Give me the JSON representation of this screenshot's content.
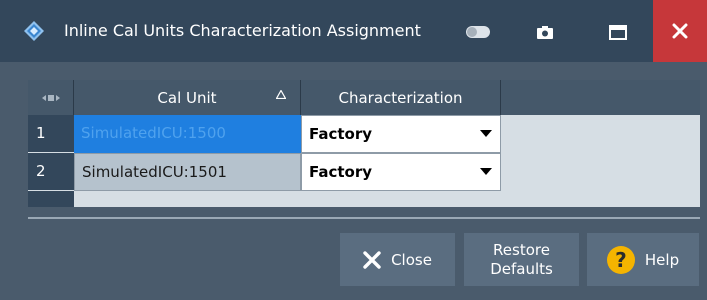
{
  "window": {
    "title": "Inline Cal Units Characterization Assignment"
  },
  "title_bar": {
    "icons": [
      "rs-logo-icon",
      "toggle-icon",
      "camera-icon",
      "maximize-icon",
      "close-icon"
    ],
    "colors": {
      "bar": "#33475b",
      "close_button": "#c6373a"
    }
  },
  "table": {
    "columns": [
      "Cal Unit",
      "Characterization"
    ],
    "sort_indicator": "△",
    "rows": [
      {
        "index": "1",
        "cal_unit": "SimulatedICU:1500",
        "characterization": "Factory",
        "selected": true
      },
      {
        "index": "2",
        "cal_unit": "SimulatedICU:1501",
        "characterization": "Factory",
        "selected": false
      }
    ]
  },
  "buttons": {
    "close": "Close",
    "restore_line1": "Restore",
    "restore_line2": "Defaults",
    "help": "Help"
  },
  "colors": {
    "selected_cell": "#1f7fe0",
    "help_badge": "#f5b400"
  }
}
